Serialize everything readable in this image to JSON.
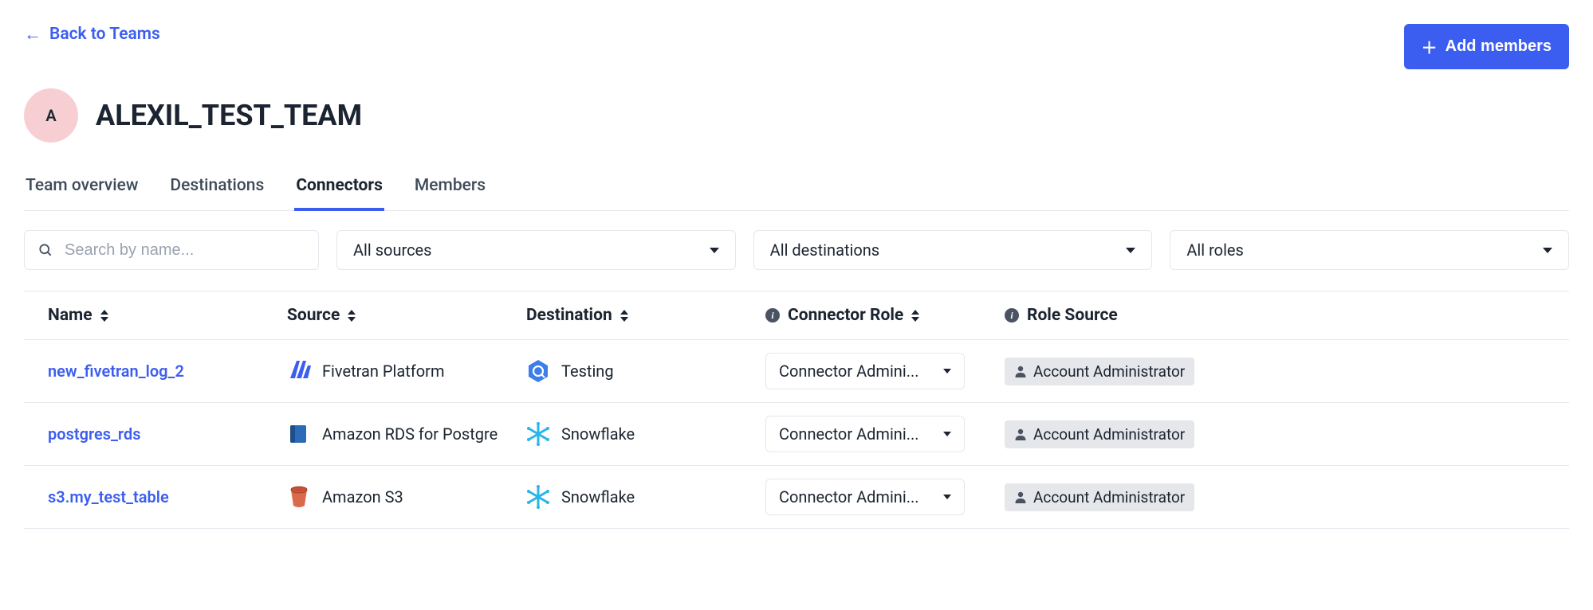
{
  "header": {
    "back_label": "Back to Teams",
    "add_members_label": "Add members",
    "avatar_letter": "A",
    "team_name": "ALEXIL_TEST_TEAM"
  },
  "tabs": [
    {
      "label": "Team overview",
      "active": false
    },
    {
      "label": "Destinations",
      "active": false
    },
    {
      "label": "Connectors",
      "active": true
    },
    {
      "label": "Members",
      "active": false
    }
  ],
  "filters": {
    "search_placeholder": "Search by name...",
    "source_label": "All sources",
    "destination_label": "All destinations",
    "role_label": "All roles"
  },
  "columns": {
    "name": "Name",
    "source": "Source",
    "destination": "Destination",
    "connector_role": "Connector Role",
    "role_source": "Role Source"
  },
  "rows": [
    {
      "name": "new_fivetran_log_2",
      "source": "Fivetran Platform",
      "source_icon": "fivetran",
      "destination": "Testing",
      "destination_icon": "bigquery",
      "role": "Connector Admini...",
      "role_source": "Account Administrator"
    },
    {
      "name": "postgres_rds",
      "source": "Amazon RDS for Postgre",
      "source_icon": "rds",
      "destination": "Snowflake",
      "destination_icon": "snowflake",
      "role": "Connector Admini...",
      "role_source": "Account Administrator"
    },
    {
      "name": "s3.my_test_table",
      "source": "Amazon S3",
      "source_icon": "s3",
      "destination": "Snowflake",
      "destination_icon": "snowflake",
      "role": "Connector Admini...",
      "role_source": "Account Administrator"
    }
  ]
}
